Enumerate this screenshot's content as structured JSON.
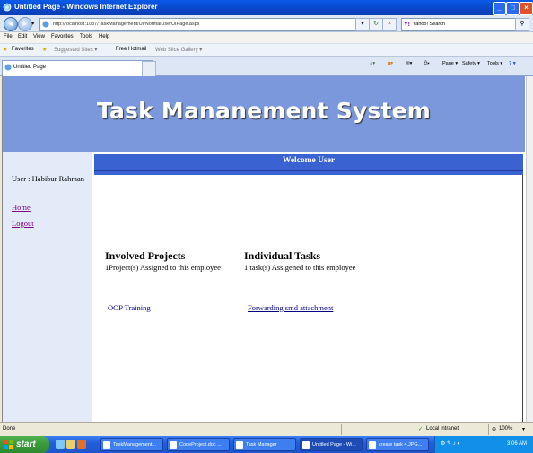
{
  "window": {
    "title": "Untitled Page - Windows Internet Explorer",
    "minimize": "_",
    "maximize": "□",
    "close": "×"
  },
  "browser": {
    "address": "http://localhost:1037/TaskManagement/UI/NormalUserUIPage.aspx",
    "search_placeholder": "Yahoo! Search",
    "search_brand": "Y!",
    "back": "◄",
    "forward": "►",
    "dropdown": "▾",
    "refresh": "↻",
    "stop": "×",
    "search_go": "⚲",
    "menu": [
      "File",
      "Edit",
      "View",
      "Favorites",
      "Tools",
      "Help"
    ],
    "favorites_label": "Favorites",
    "favorites_items": [
      "Suggested Sites ▾",
      "Free Hotmail",
      "Web Slice Gallery ▾"
    ],
    "tab_title": "Untitled Page",
    "commands": [
      "Page ▾",
      "Safety ▾",
      "Tools ▾",
      "? ▾"
    ]
  },
  "page": {
    "banner_title": "Task Mananement System",
    "welcome": "Welcome User",
    "user_label": "User : Habibur Rahman",
    "nav_links": [
      "Home",
      "Logout"
    ],
    "projects": {
      "heading": "Involved Projects",
      "summary": "1Project(s) Assigned to this employee",
      "items": [
        "OOP Training"
      ]
    },
    "tasks": {
      "heading": "Individual Tasks",
      "summary": "1 task(s) Assigened to this employee",
      "items": [
        "Forwarding smd attachment"
      ]
    }
  },
  "status": {
    "left": "Done",
    "zone": "Local intranet",
    "zoom": "100%"
  },
  "taskbar": {
    "start": "start",
    "items": [
      "TaskManagement...",
      "CodeProject.doc ...",
      "Task Manager",
      "Untitled Page - Wi...",
      "create task 4.JPG..."
    ],
    "clock": "3:06 AM"
  },
  "colors": {
    "banner": "#7b98dc",
    "welcome_bar": "#3a62d0",
    "left_column": "#e3eaf8",
    "visited_link": "#800080"
  }
}
